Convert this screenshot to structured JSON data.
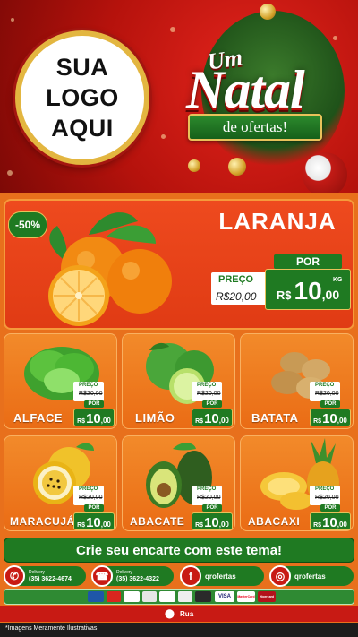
{
  "header": {
    "logo_lines": [
      "SUA",
      "LOGO",
      "AQUI"
    ],
    "title_small": "Um",
    "title_big": "Natal",
    "title_ribbon": "de ofertas!"
  },
  "featured": {
    "discount": "-50%",
    "name": "LARANJA",
    "preco_label": "PREÇO",
    "old_price": "R$20,00",
    "por_label": "POR",
    "currency": "R$",
    "price_int": "10",
    "price_dec": ",00",
    "unit": "KG"
  },
  "products": [
    {
      "name": "ALFACE",
      "preco_label": "PREÇO",
      "old_price": "R$20,00",
      "por_label": "POR",
      "currency": "R$",
      "price_int": "10",
      "price_dec": ",00",
      "unit": "KG"
    },
    {
      "name": "LIMÃO",
      "preco_label": "PREÇO",
      "old_price": "R$20,00",
      "por_label": "POR",
      "currency": "R$",
      "price_int": "10",
      "price_dec": ",00",
      "unit": "KG"
    },
    {
      "name": "BATATA",
      "preco_label": "PREÇO",
      "old_price": "R$20,00",
      "por_label": "POR",
      "currency": "R$",
      "price_int": "10",
      "price_dec": ",00",
      "unit": "KG"
    },
    {
      "name": "MARACUJÁ",
      "preco_label": "PREÇO",
      "old_price": "R$20,00",
      "por_label": "POR",
      "currency": "R$",
      "price_int": "10",
      "price_dec": ",00",
      "unit": "KG"
    },
    {
      "name": "ABACATE",
      "preco_label": "PREÇO",
      "old_price": "R$20,00",
      "por_label": "POR",
      "currency": "R$",
      "price_int": "10",
      "price_dec": ",00",
      "unit": "KG"
    },
    {
      "name": "ABACAXI",
      "preco_label": "PREÇO",
      "old_price": "R$20,00",
      "por_label": "POR",
      "currency": "R$",
      "price_int": "10",
      "price_dec": ",00",
      "unit": "KG"
    }
  ],
  "footer": {
    "cta": "Crie seu encarte com este tema!",
    "whatsapp": {
      "label": "Delivery",
      "value": "(35) 3622-4674",
      "icon": "whatsapp-icon"
    },
    "phone": {
      "label": "Delivery",
      "value": "(35) 3622-4322",
      "icon": "phone-icon"
    },
    "facebook": {
      "value": "qrofertas",
      "icon": "facebook-icon"
    },
    "instagram": {
      "value": "qrofertas",
      "icon": "instagram-icon"
    },
    "payment_methods": [
      "VISA",
      "MasterCard",
      "Hipercard"
    ],
    "address": "Rua",
    "disclaimer": "*Imagens Meramente Ilustrativas"
  },
  "colors": {
    "brand_red": "#c81a14",
    "brand_green": "#1f7a22",
    "panel_orange": "#e8701c",
    "gold": "#e8c25a"
  }
}
